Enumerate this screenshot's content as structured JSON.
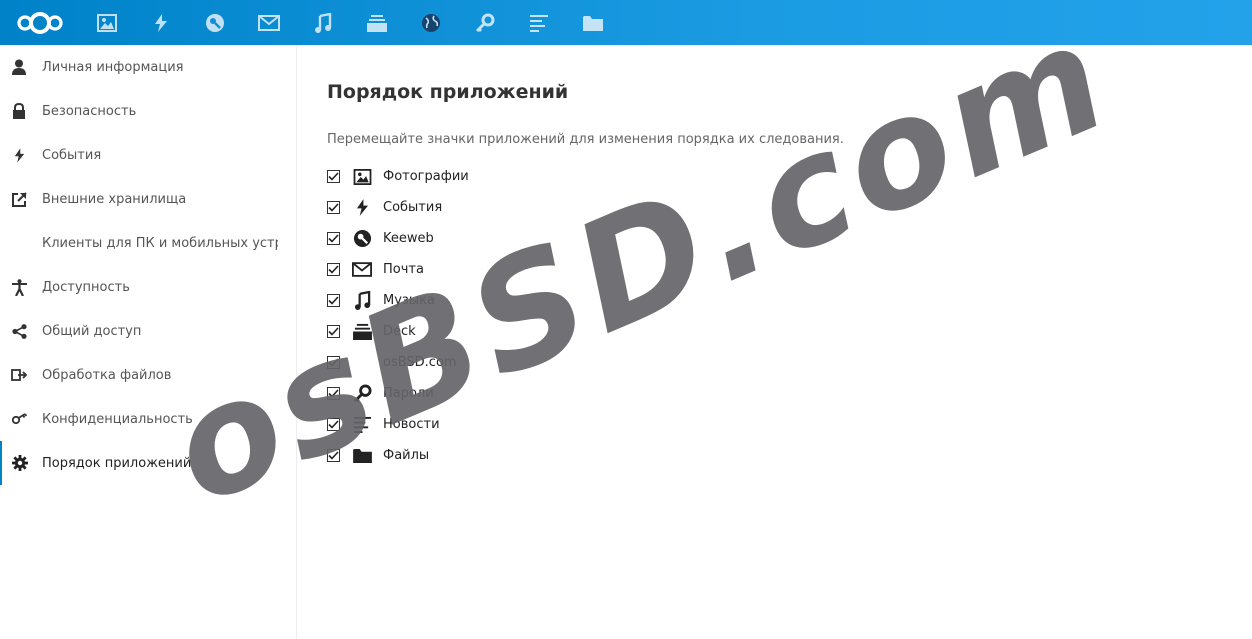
{
  "header": {
    "apps": [
      {
        "name": "photos-icon"
      },
      {
        "name": "activity-icon"
      },
      {
        "name": "keeweb-icon"
      },
      {
        "name": "mail-icon"
      },
      {
        "name": "music-icon"
      },
      {
        "name": "deck-icon"
      },
      {
        "name": "globe-icon"
      },
      {
        "name": "passwords-icon"
      },
      {
        "name": "news-icon"
      },
      {
        "name": "files-icon"
      }
    ]
  },
  "sidebar": {
    "items": [
      {
        "label": "Личная информация",
        "icon": "user-icon"
      },
      {
        "label": "Безопасность",
        "icon": "lock-icon"
      },
      {
        "label": "События",
        "icon": "activity-icon"
      },
      {
        "label": "Внешние хранилища",
        "icon": "external-link-icon"
      },
      {
        "label": "Клиенты для ПК и мобильных устро",
        "icon": ""
      },
      {
        "label": "Доступность",
        "icon": "accessibility-icon"
      },
      {
        "label": "Общий доступ",
        "icon": "share-icon"
      },
      {
        "label": "Обработка файлов",
        "icon": "file-flow-icon"
      },
      {
        "label": "Конфиденциальность",
        "icon": "key-icon"
      },
      {
        "label": "Порядок приложений",
        "icon": "gear-icon",
        "active": true
      }
    ]
  },
  "main": {
    "title": "Порядок приложений",
    "hint": "Перемещайте значки приложений для изменения порядка их следования.",
    "apps": [
      {
        "label": "Фотографии",
        "icon": "photos-icon",
        "checked": true
      },
      {
        "label": "События",
        "icon": "activity-icon",
        "checked": true
      },
      {
        "label": "Keeweb",
        "icon": "keeweb-icon",
        "checked": true
      },
      {
        "label": "Почта",
        "icon": "mail-icon",
        "checked": true
      },
      {
        "label": "Музыка",
        "icon": "music-icon",
        "checked": true
      },
      {
        "label": "Deck",
        "icon": "deck-icon",
        "checked": true
      },
      {
        "label": "osBSD.com",
        "icon": "",
        "checked": true
      },
      {
        "label": "Пароли",
        "icon": "passwords-icon",
        "checked": true
      },
      {
        "label": "Новости",
        "icon": "news-icon",
        "checked": true
      },
      {
        "label": "Файлы",
        "icon": "files-icon",
        "checked": true
      }
    ]
  },
  "watermark": {
    "text": "osBSD.com"
  },
  "colors": {
    "header": "#0082c9",
    "accent": "#0082c9",
    "icon_dark": "#222222"
  }
}
